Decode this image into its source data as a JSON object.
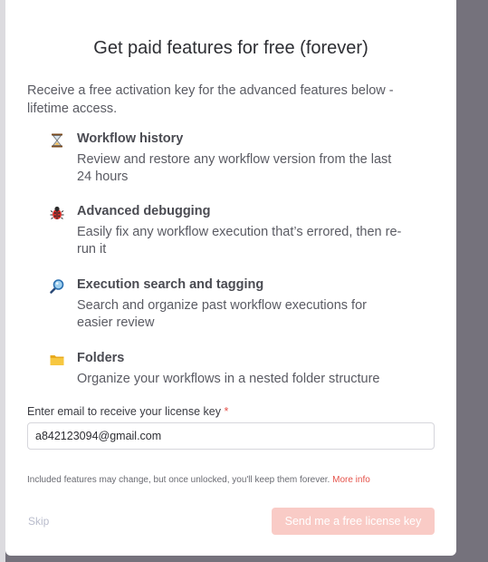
{
  "modal": {
    "title": "Get paid features for free (forever)",
    "intro": "Receive a free activation key for the advanced features below - lifetime access.",
    "features": [
      {
        "icon": "hourglass-icon",
        "title": "Workflow history",
        "description": "Review and restore any workflow version from the last 24 hours"
      },
      {
        "icon": "bug-icon",
        "title": "Advanced debugging",
        "description": "Easily fix any workflow execution that’s errored, then re-run it"
      },
      {
        "icon": "magnifier-icon",
        "title": "Execution search and tagging",
        "description": "Search and organize past workflow executions for easier review"
      },
      {
        "icon": "folder-icon",
        "title": "Folders",
        "description": "Organize your workflows in a nested folder structure"
      }
    ],
    "email": {
      "label": "Enter email to receive your license key",
      "required_marker": "*",
      "value": "a842123094@gmail.com"
    },
    "note": "Included features may change, but once unlocked, you'll keep them forever.",
    "more_info": "More info",
    "skip_label": "Skip",
    "send_label": "Send me a free license key"
  },
  "colors": {
    "accent": "#e5534b",
    "button_disabled": "#f9cbc6",
    "overlay": "#75727c"
  }
}
